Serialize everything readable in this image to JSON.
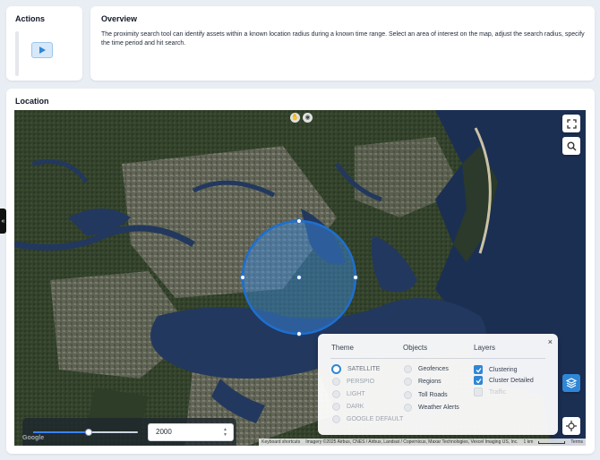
{
  "actions": {
    "title": "Actions",
    "play_icon": "play-icon"
  },
  "overview": {
    "title": "Overview",
    "text": "The proximity search tool can identify assets within a known location radius during a known time range. Select an area of interest on the map, adjust the search radius, specify the time period and hit search."
  },
  "location": {
    "title": "Location"
  },
  "side_handle": {
    "icon": "double-chevron-icon",
    "glyph": "«"
  },
  "map": {
    "top_controls": [
      "pan-icon",
      "settings-icon"
    ],
    "controls": {
      "fullscreen": "fullscreen-icon",
      "search": "search-icon",
      "layers": "layers-icon",
      "locate": "crosshair-icon"
    },
    "search_area": {
      "shape": "circle",
      "fill_color": "#3b8ee6",
      "stroke_color": "#1e6fd0"
    },
    "radius": {
      "value": "2000",
      "slider_level": 0.53,
      "stepper_up": "▲",
      "stepper_down": "▼"
    },
    "google_logo": "Google",
    "attribution": {
      "shortcuts": "Keyboard shortcuts",
      "imagery": "Imagery ©2025 Airbus, CNES / Airbus, Landsat / Copernicus, Maxar Technologies, Vexcel Imaging US, Inc.",
      "scale": "1 km",
      "terms": "Terms"
    }
  },
  "layers_panel": {
    "close": "×",
    "headers": {
      "theme": "Theme",
      "objects": "Objects",
      "layers": "Layers"
    },
    "themes": [
      {
        "label": "SATELLITE",
        "selected": true
      },
      {
        "label": "PERSPIO",
        "selected": false
      },
      {
        "label": "LIGHT",
        "selected": false
      },
      {
        "label": "DARK",
        "selected": false
      },
      {
        "label": "GOOGLE DEFAULT",
        "selected": false
      }
    ],
    "objects": [
      "Geofences",
      "Regions",
      "Toll Roads",
      "Weather Alerts"
    ],
    "layers": [
      {
        "label": "Clustering",
        "checked": true,
        "enabled": true
      },
      {
        "label": "Cluster Detailed",
        "checked": true,
        "enabled": true
      },
      {
        "label": "Traffic",
        "checked": false,
        "enabled": false
      }
    ]
  },
  "colors": {
    "accent": "#2f86d6",
    "water": "#1b2f52",
    "land": "#3f4c35"
  }
}
